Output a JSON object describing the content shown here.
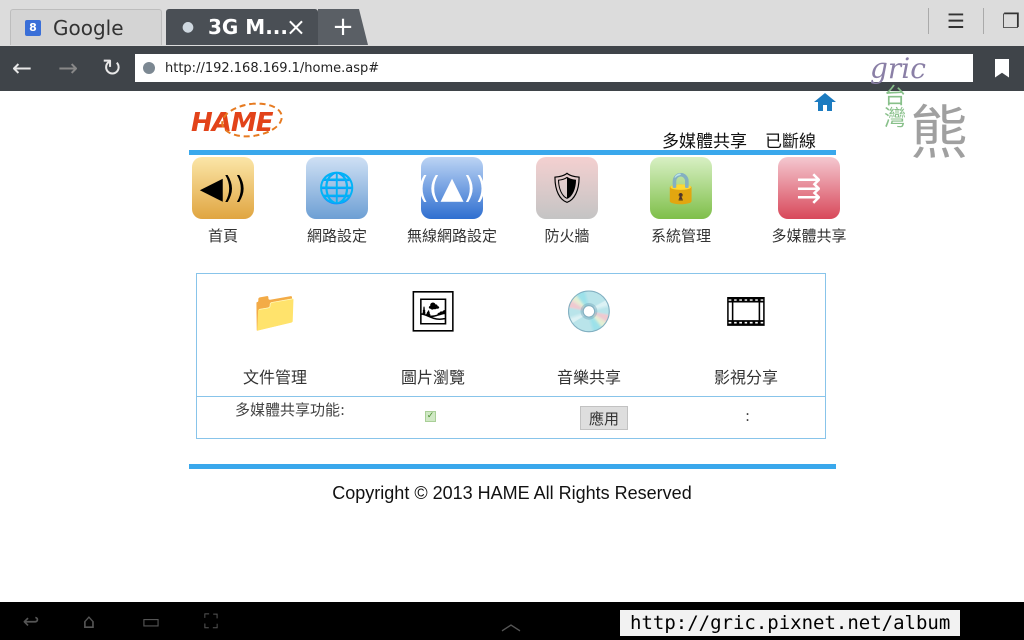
{
  "browser": {
    "tabs": [
      {
        "favicon": "8",
        "title": "Google"
      },
      {
        "favicon": "●",
        "title": "3G M..."
      }
    ],
    "new_tab_symbol": "+",
    "url": "http://192.168.169.1/home.asp#"
  },
  "page": {
    "logo": "HAME",
    "status": {
      "mode": "多媒體共享",
      "connection": "已斷線"
    },
    "nav": [
      {
        "label": "首頁",
        "icon": "speaker-icon",
        "color": "#f2c86a"
      },
      {
        "label": "網路設定",
        "icon": "globe-check-icon",
        "color": "#6d9fd4"
      },
      {
        "label": "無線網路設定",
        "icon": "wireless-tower-icon",
        "color": "#2f6fd0"
      },
      {
        "label": "防火牆",
        "icon": "shield-icon",
        "color": "#e3504f"
      },
      {
        "label": "系統管理",
        "icon": "padlock-icon",
        "color": "#7fbf4a"
      },
      {
        "label": "多媒體共享",
        "icon": "usb-drive-icon",
        "color": "#d8485a"
      }
    ],
    "media": [
      {
        "label": "文件管理",
        "icon": "folder-icon"
      },
      {
        "label": "圖片瀏覽",
        "icon": "photo-icon"
      },
      {
        "label": "音樂共享",
        "icon": "music-disc-icon"
      },
      {
        "label": "影視分享",
        "icon": "film-reel-icon"
      }
    ],
    "feature": {
      "label": "多媒體共享功能:",
      "enabled": true,
      "apply_label": "應用",
      "extra": ":"
    },
    "copyright": "Copyright © 2013 HAME All Rights Reserved"
  },
  "watermark": {
    "script": "gric",
    "chars_left": "台灣",
    "char_big": "熊"
  },
  "overlay_url": "http://gric.pixnet.net/album"
}
